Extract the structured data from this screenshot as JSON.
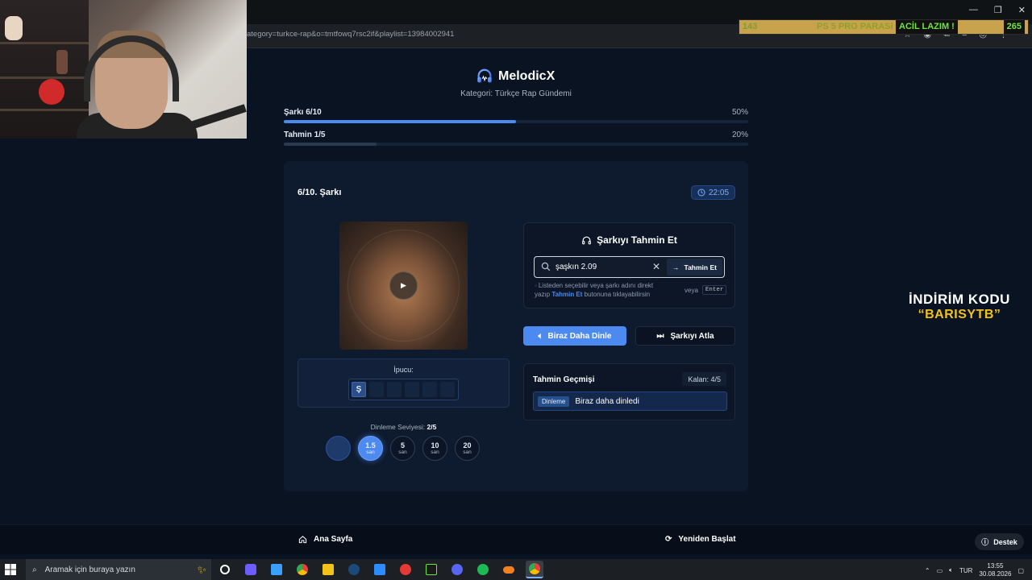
{
  "browser": {
    "url": "ategory=turkce-rap&o=tmtfowq7rsc2if&playlist=13984002941",
    "ticker": {
      "left_count": "143",
      "message_part1": "PS 5 PRO PARASI",
      "message_part2": "ACİL LAZIM !",
      "right_count": "265"
    }
  },
  "app": {
    "name": "MelodicX",
    "category_label": "Kategori: Türkçe Rap Gündemi"
  },
  "progress": {
    "song": {
      "label": "Şarkı 6/10",
      "percent_label": "50%",
      "percent": 50,
      "color": "#4c8af0"
    },
    "guess": {
      "label": "Tahmin 1/5",
      "percent_label": "20%",
      "percent": 20,
      "color": "#2a3a52"
    }
  },
  "round": {
    "title": "6/10. Şarkı",
    "timer": "22:05"
  },
  "hint": {
    "label": "İpucu:",
    "letters": [
      "Ş",
      "",
      "",
      "",
      "",
      ""
    ]
  },
  "listen_level": {
    "label": "Dinleme Seviyesi:",
    "value": "2/5",
    "levels": [
      {
        "value": "",
        "unit": "",
        "state": "done"
      },
      {
        "value": "1.5",
        "unit": "san",
        "state": "active"
      },
      {
        "value": "5",
        "unit": "san",
        "state": "idle"
      },
      {
        "value": "10",
        "unit": "san",
        "state": "idle"
      },
      {
        "value": "20",
        "unit": "san",
        "state": "idle"
      }
    ]
  },
  "guess": {
    "title": "Şarkıyı Tahmin Et",
    "input_value": "şaşkın 2.09",
    "submit_label": "Tahmin Et",
    "helper_line1": "Listeden seçebilir veya şarkı adını direkt",
    "helper_line2_pre": "yazıp",
    "helper_line2_link": "Tahmin Et",
    "helper_line2_post": "butonuna tıklayabilirsin",
    "or_label": "veya",
    "enter_key": "Enter"
  },
  "actions": {
    "listen_more": "Biraz Daha Dinle",
    "skip": "Şarkıyı Atla"
  },
  "history": {
    "title": "Tahmin Geçmişi",
    "remaining": "Kalan: 4/5",
    "entries": [
      {
        "tag": "Dinleme",
        "text": "Biraz daha dinledi"
      }
    ]
  },
  "footer": {
    "home": "Ana Sayfa",
    "restart": "Yeniden Başlat",
    "support": "Destek"
  },
  "promo": {
    "line1": "İNDİRİM KODU",
    "line2": "“BARISYTB”"
  },
  "taskbar": {
    "search_placeholder": "Aramak için buraya yazın",
    "language": "TUR",
    "time": "13:55",
    "date": "30.08.2026"
  },
  "colors": {
    "accent": "#4c8af0",
    "background": "#0a1322",
    "promo_yellow": "#f2c21b"
  }
}
